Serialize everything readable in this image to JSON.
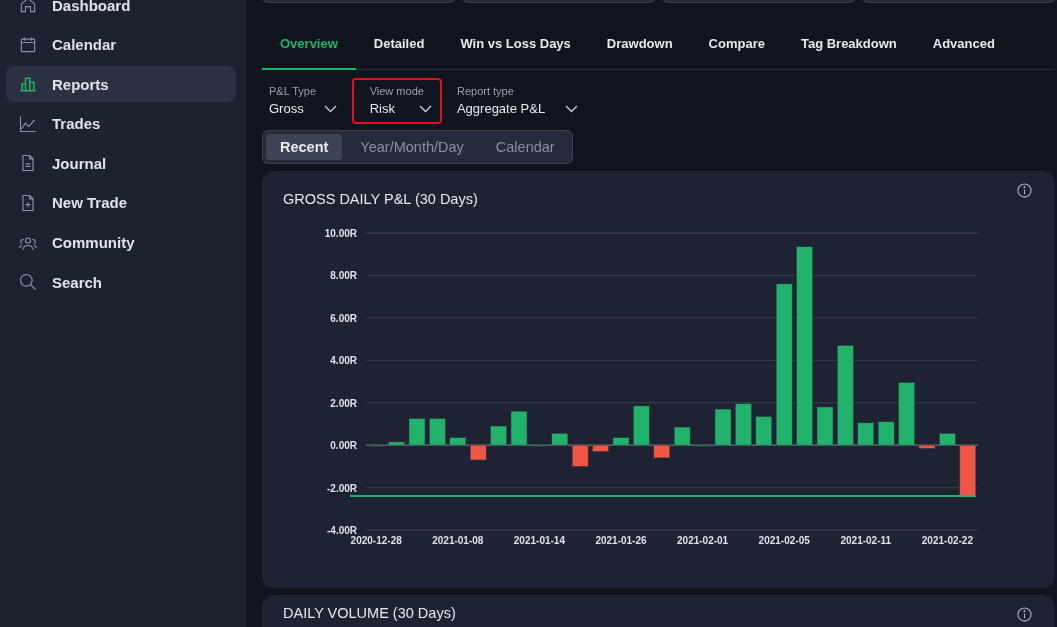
{
  "summary_cards": [
    {
      "kind": "card"
    },
    {
      "kind": "card"
    },
    {
      "kind": "card"
    },
    {
      "kind": "card"
    }
  ],
  "sidebar": {
    "items": [
      {
        "label": "Dashboard",
        "selected": false
      },
      {
        "label": "Calendar",
        "selected": false
      },
      {
        "label": "Reports",
        "selected": true
      },
      {
        "label": "Trades",
        "selected": false
      },
      {
        "label": "Journal",
        "selected": false
      },
      {
        "label": "New Trade",
        "selected": false
      },
      {
        "label": "Community",
        "selected": false
      },
      {
        "label": "Search",
        "selected": false
      }
    ]
  },
  "tabs": [
    {
      "label": "Overview",
      "selected": true
    },
    {
      "label": "Detailed",
      "selected": false
    },
    {
      "label": "Win vs Loss Days",
      "selected": false
    },
    {
      "label": "Drawdown",
      "selected": false
    },
    {
      "label": "Compare",
      "selected": false
    },
    {
      "label": "Tag Breakdown",
      "selected": false
    },
    {
      "label": "Advanced",
      "selected": false
    }
  ],
  "filters": [
    {
      "label": "P&L Type",
      "value": "Gross",
      "highlighted": false
    },
    {
      "label": "View mode",
      "value": "Risk",
      "highlighted": true
    },
    {
      "label": "Report type",
      "value": "Aggregate P&L",
      "highlighted": false
    }
  ],
  "range_tabs": [
    {
      "label": "Recent",
      "selected": true
    },
    {
      "label": "Year/Month/Day",
      "selected": false
    },
    {
      "label": "Calendar",
      "selected": false
    }
  ],
  "cards": [
    {
      "title": "GROSS DAILY P&L (30 Days)",
      "chart_data": {
        "type": "bar",
        "values": [
          0,
          0.15,
          1.25,
          1.25,
          0.35,
          -0.7,
          0.9,
          1.6,
          0,
          0.55,
          -1.0,
          -0.3,
          0.35,
          1.85,
          -0.6,
          0.85,
          0,
          1.7,
          1.95,
          1.35,
          7.6,
          9.35,
          1.8,
          4.7,
          1.05,
          1.1,
          2.95,
          -0.15,
          0.55,
          -2.45
        ],
        "ylim": [
          -4,
          10
        ],
        "yticks": [
          {
            "value": -4,
            "label": "-4.00R"
          },
          {
            "value": -2,
            "label": "-2.00R"
          },
          {
            "value": 0,
            "label": "0.00R"
          },
          {
            "value": 2,
            "label": "2.00R"
          },
          {
            "value": 4,
            "label": "4.00R"
          },
          {
            "value": 6,
            "label": "6.00R"
          },
          {
            "value": 8,
            "label": "8.00R"
          },
          {
            "value": 10,
            "label": "10.00R"
          }
        ],
        "categories": [
          "2020-12-28",
          null,
          null,
          null,
          "2021-01-08",
          null,
          null,
          null,
          "2021-01-14",
          null,
          null,
          null,
          "2021-01-26",
          null,
          null,
          null,
          "2021-02-01",
          null,
          null,
          null,
          "2021-02-05",
          null,
          null,
          null,
          "2021-02-11",
          null,
          null,
          null,
          "2021-02-22",
          null
        ],
        "grid": true,
        "ref_lines": [
          {
            "axis": "y",
            "value": -2.4,
            "color": "#21b26b"
          }
        ]
      }
    },
    {
      "title": "DAILY VOLUME (30 Days)"
    }
  ]
}
